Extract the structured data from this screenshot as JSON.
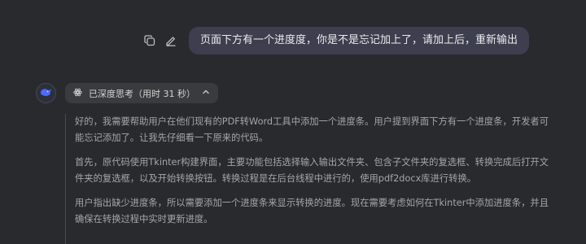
{
  "user_message": {
    "text": "页面下方有一个进度度，你是不是忘记加上了，请加上后，重新输出",
    "actions": [
      "copy-icon",
      "edit-icon"
    ]
  },
  "assistant": {
    "avatar_icon": "whale-icon",
    "thinking_toggle": {
      "icon": "deep-think-icon",
      "label": "已深度思考（用时 31 秒）",
      "chevron": "chevron-up-icon"
    },
    "thinking_paragraphs": [
      "好的，我需要帮助用户在他们现有的PDF转Word工具中添加一个进度条。用户提到界面下方有一个进度条，开发者可能忘记添加了。让我先仔细看一下原来的代码。",
      "首先，原代码使用Tkinter构建界面，主要功能包括选择输入输出文件夹、包含子文件夹的复选框、转换完成后打开文件夹的复选框，以及开始转换按钮。转换过程是在后台线程中进行的，使用pdf2docx库进行转换。",
      "用户指出缺少进度条，所以需要添加一个进度条来显示转换的进度。现在需要考虑如何在Tkinter中添加进度条，并且确保在转换过程中实时更新进度。"
    ]
  },
  "colors": {
    "background": "#292a2d",
    "user_bubble": "#3d3e4e",
    "thinking_text": "#a6a6ab",
    "accent": "#4d6bfe"
  }
}
